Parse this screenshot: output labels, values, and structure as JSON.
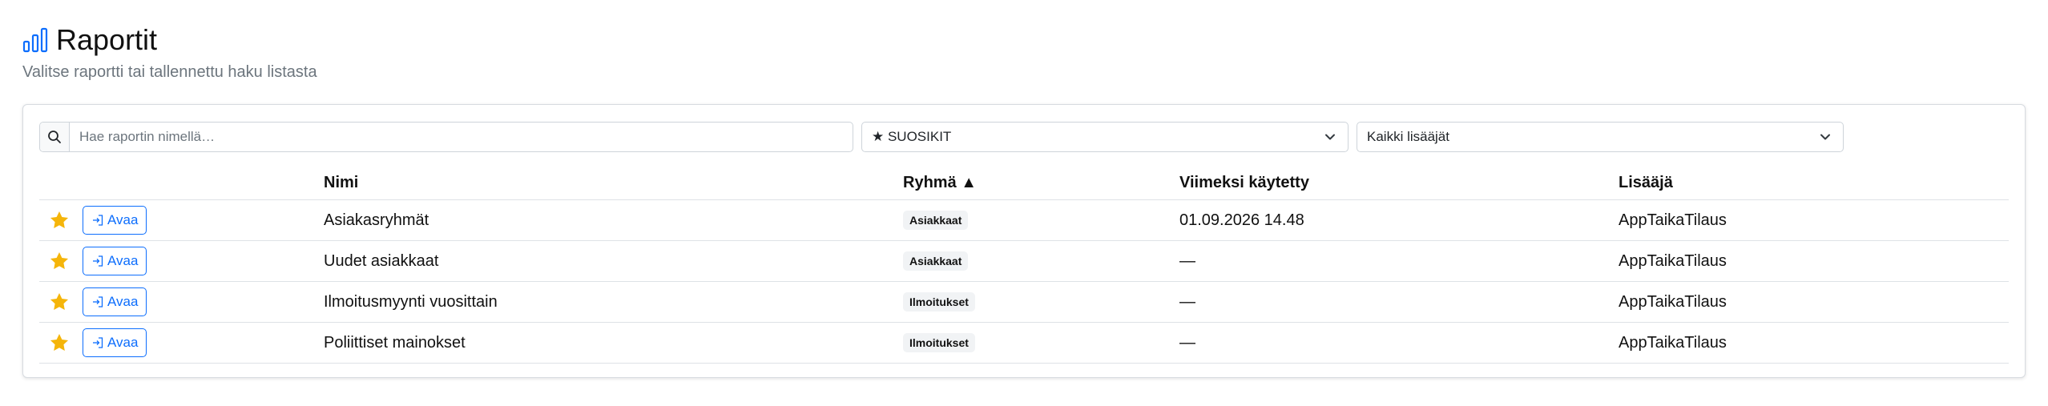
{
  "page": {
    "title": "Raportit",
    "subtitle": "Valitse raportti tai tallennettu haku listasta"
  },
  "filters": {
    "search_placeholder": "Hae raportin nimellä…",
    "favorites_select": "★ SUOSIKIT",
    "adder_select": "Kaikki lisääjät"
  },
  "table": {
    "headers": {
      "name": "Nimi",
      "group": "Ryhmä ▲",
      "last_used": "Viimeksi käytetty",
      "adder": "Lisääjä"
    },
    "open_label": "Avaa",
    "rows": [
      {
        "name": "Asiakasryhmät",
        "group": "Asiakkaat",
        "last_used": "01.09.2026 14.48",
        "adder": "AppTaikaTilaus"
      },
      {
        "name": "Uudet asiakkaat",
        "group": "Asiakkaat",
        "last_used": "—",
        "adder": "AppTaikaTilaus"
      },
      {
        "name": "Ilmoitusmyynti vuosittain",
        "group": "Ilmoitukset",
        "last_used": "—",
        "adder": "AppTaikaTilaus"
      },
      {
        "name": "Poliittiset mainokset",
        "group": "Ilmoitukset",
        "last_used": "—",
        "adder": "AppTaikaTilaus"
      }
    ]
  },
  "colors": {
    "accent": "#0d6efd",
    "star": "#f5b50a"
  }
}
